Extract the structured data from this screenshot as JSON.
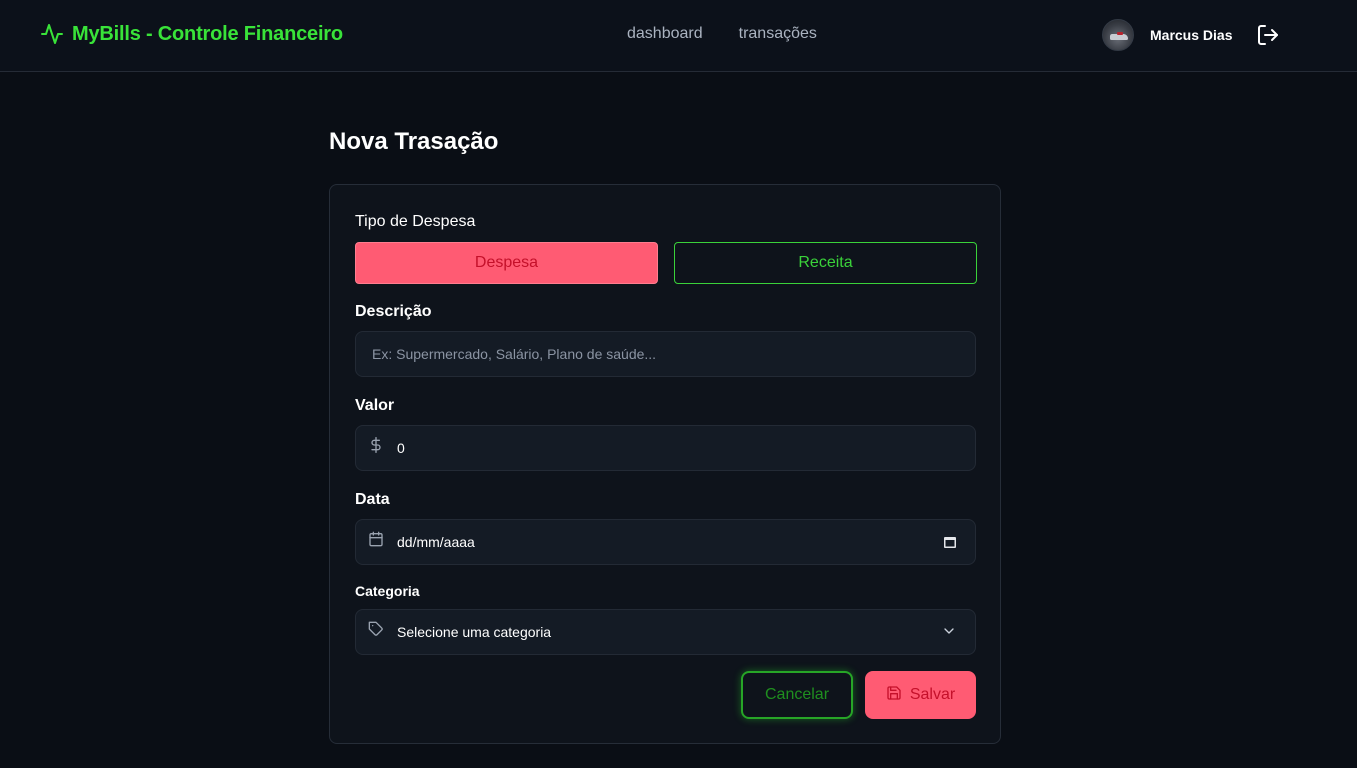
{
  "header": {
    "brand_title": "MyBills - Controle Financeiro",
    "nav": [
      {
        "label": "dashboard"
      },
      {
        "label": "transações"
      }
    ],
    "user_name": "Marcus Dias",
    "logout_icon": "logout-icon"
  },
  "main": {
    "page_title": "Nova Trasação",
    "form": {
      "type_label": "Tipo de Despesa",
      "expense_label": "Despesa",
      "income_label": "Receita",
      "selected_type": "Despesa",
      "description_label": "Descrição",
      "description_placeholder": "Ex: Supermercado, Salário, Plano de saúde...",
      "description_value": "",
      "value_label": "Valor",
      "value_icon": "dollar-sign-icon",
      "value_value": "0",
      "date_label": "Data",
      "date_icon": "calendar-icon",
      "date_value": "dd/mm/aaaa",
      "category_label": "Categoria",
      "category_icon": "tag-icon",
      "category_value": "Selecione uma categoria",
      "cancel_label": "Cancelar",
      "save_label": "Salvar",
      "save_icon": "save-icon"
    }
  },
  "colors": {
    "brand_green": "#39e339",
    "expense_red": "#ff5b73",
    "expense_text": "#c4102a",
    "income_green": "#3ad23a",
    "background": "#0a0e15",
    "card": "#0e131b",
    "field": "#141b25"
  }
}
